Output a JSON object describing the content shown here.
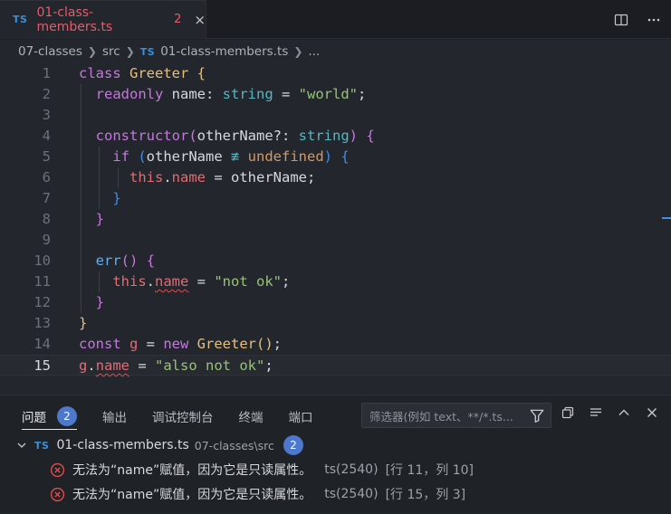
{
  "tab": {
    "lang_icon": "TS",
    "title": "01-class-members.ts",
    "problem_count": "2",
    "close_glyph": "×"
  },
  "tab_actions": [
    "split-editor-icon",
    "more-actions-icon"
  ],
  "breadcrumb": {
    "items": [
      "07-classes",
      "src",
      "01-class-members.ts",
      "..."
    ],
    "lang_icon": "TS"
  },
  "editor": {
    "line_numbers": [
      "1",
      "2",
      "3",
      "4",
      "5",
      "6",
      "7",
      "8",
      "9",
      "10",
      "11",
      "12",
      "13",
      "14",
      "15"
    ],
    "active_line": 15,
    "lines": [
      [
        [
          "k",
          "class "
        ],
        [
          "cls",
          "Greeter "
        ],
        [
          "brace1",
          "{"
        ]
      ],
      [
        [
          "plain",
          "  "
        ],
        [
          "k",
          "readonly "
        ],
        [
          "plain",
          "name"
        ],
        [
          "plain",
          ": "
        ],
        [
          "type",
          "string"
        ],
        [
          "plain",
          " = "
        ],
        [
          "str",
          "\"world\""
        ],
        [
          "plain",
          ";"
        ]
      ],
      [],
      [
        [
          "plain",
          "  "
        ],
        [
          "k",
          "constructor"
        ],
        [
          "brace2",
          "("
        ],
        [
          "plain",
          "otherName"
        ],
        [
          "plain",
          "?: "
        ],
        [
          "type",
          "string"
        ],
        [
          "brace2",
          ")"
        ],
        [
          "plain",
          " "
        ],
        [
          "brace2",
          "{"
        ]
      ],
      [
        [
          "plain",
          "    "
        ],
        [
          "k",
          "if "
        ],
        [
          "brace3",
          "("
        ],
        [
          "plain",
          "otherName "
        ],
        [
          "op",
          "≢ "
        ],
        [
          "kb",
          "undefined"
        ],
        [
          "brace3",
          ")"
        ],
        [
          "plain",
          " "
        ],
        [
          "brace3",
          "{"
        ]
      ],
      [
        [
          "plain",
          "      "
        ],
        [
          "prop",
          "this"
        ],
        [
          "plain",
          "."
        ],
        [
          "prop",
          "name"
        ],
        [
          "plain",
          " = otherName;"
        ]
      ],
      [
        [
          "plain",
          "    "
        ],
        [
          "brace3",
          "}"
        ]
      ],
      [
        [
          "plain",
          "  "
        ],
        [
          "brace2",
          "}"
        ]
      ],
      [],
      [
        [
          "plain",
          "  "
        ],
        [
          "fn",
          "err"
        ],
        [
          "brace2",
          "()"
        ],
        [
          "plain",
          " "
        ],
        [
          "brace2",
          "{"
        ]
      ],
      [
        [
          "plain",
          "    "
        ],
        [
          "prop",
          "this"
        ],
        [
          "plain",
          "."
        ],
        [
          "prop squig",
          "name"
        ],
        [
          "plain",
          " = "
        ],
        [
          "str",
          "\"not ok\""
        ],
        [
          "plain",
          ";"
        ]
      ],
      [
        [
          "plain",
          "  "
        ],
        [
          "brace2",
          "}"
        ]
      ],
      [
        [
          "brace1",
          "}"
        ]
      ],
      [
        [
          "k",
          "const "
        ],
        [
          "prop",
          "g"
        ],
        [
          "plain",
          " = "
        ],
        [
          "k",
          "new "
        ],
        [
          "cls",
          "Greeter"
        ],
        [
          "brace1",
          "()"
        ],
        [
          "plain",
          ";"
        ]
      ],
      [
        [
          "prop",
          "g"
        ],
        [
          "plain",
          "."
        ],
        [
          "prop squig",
          "name"
        ],
        [
          "plain",
          " = "
        ],
        [
          "str",
          "\"also not ok\""
        ],
        [
          "plain",
          ";"
        ]
      ]
    ]
  },
  "panel": {
    "tabs": [
      {
        "label": "问题",
        "badge": "2",
        "active": true
      },
      {
        "label": "输出"
      },
      {
        "label": "调试控制台"
      },
      {
        "label": "终端"
      },
      {
        "label": "端口"
      }
    ],
    "filter_placeholder": "筛选器(例如 text、**/*.ts...",
    "group": {
      "lang_icon": "TS",
      "file": "01-class-members.ts",
      "path": "07-classes\\src",
      "count": "2"
    },
    "errors": [
      {
        "message": "无法为“name”赋值，因为它是只读属性。",
        "code": "ts(2540)",
        "location": "[行 11，列 10]"
      },
      {
        "message": "无法为“name”赋值，因为它是只读属性。",
        "code": "ts(2540)",
        "location": "[行 15，列 3]"
      }
    ]
  },
  "colors": {
    "error": "#e34c4c",
    "accent": "#4d78cc",
    "tab_modified": "#e35d6a"
  }
}
